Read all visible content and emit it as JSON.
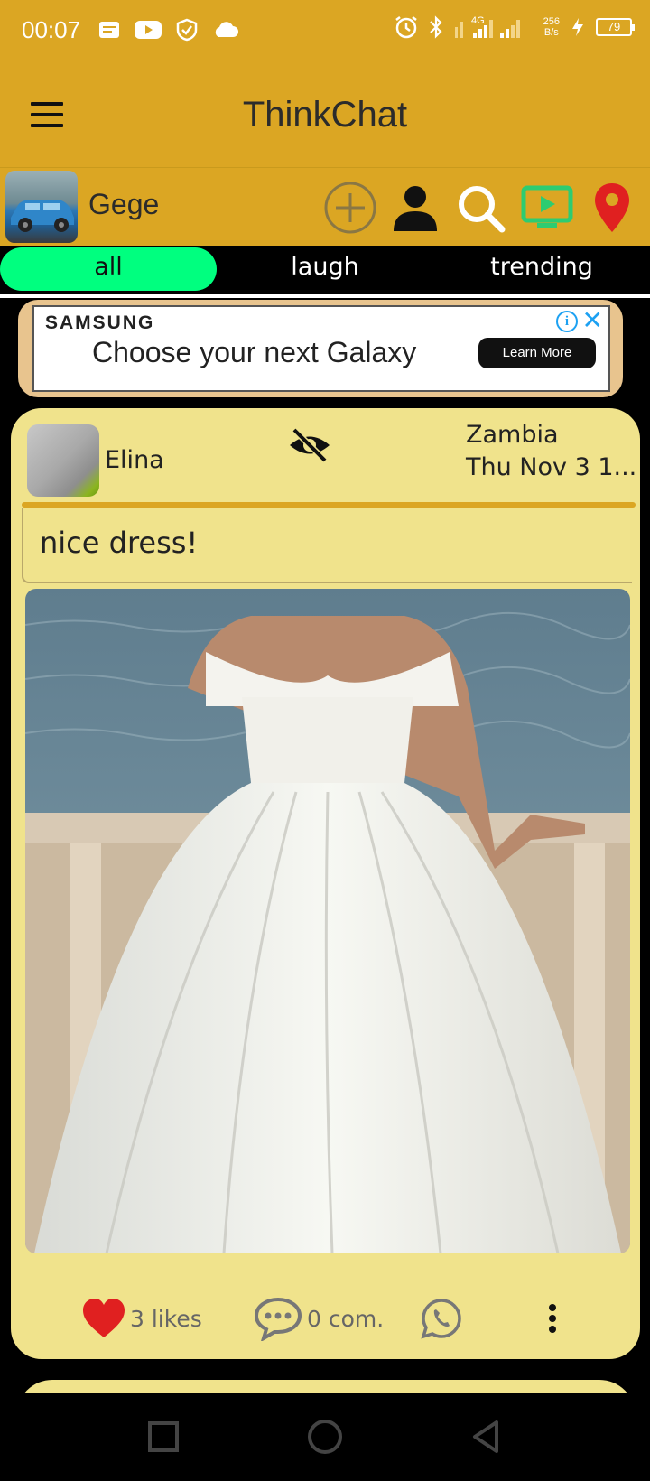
{
  "status_bar": {
    "time": "00:07",
    "network": "4G",
    "net_speed_value": "256",
    "net_speed_unit": "B/s",
    "battery": "79"
  },
  "app_bar": {
    "title": "ThinkChat"
  },
  "profile": {
    "name": "Gege"
  },
  "tabs": [
    {
      "label": "all",
      "active": true
    },
    {
      "label": "laugh",
      "active": false
    },
    {
      "label": "trending",
      "active": false
    }
  ],
  "ad": {
    "brand": "SAMSUNG",
    "headline": "Choose your next Galaxy",
    "cta": "Learn More",
    "info": "i",
    "close": "✕"
  },
  "post": {
    "author": "Elina",
    "location": "Zambia",
    "date": "Thu Nov  3 1...",
    "text": "nice dress!",
    "likes": "3 likes",
    "comments": "0 com."
  },
  "colors": {
    "header": "#DBA623",
    "tab_active": "#00FF7F",
    "post_bg": "#F0E38C",
    "like": "#E02020",
    "location_pin": "#E02020",
    "tv": "#2ECC71"
  },
  "icons": {
    "menu": "hamburger-menu-icon",
    "add": "add-circle-icon",
    "profile": "person-icon",
    "search": "search-icon",
    "tv": "tv-play-icon",
    "location": "location-pin-icon",
    "hide": "eye-slash-icon",
    "like": "heart-icon",
    "comment": "comment-bubble-icon",
    "share": "whatsapp-icon",
    "more": "more-vertical-icon"
  }
}
